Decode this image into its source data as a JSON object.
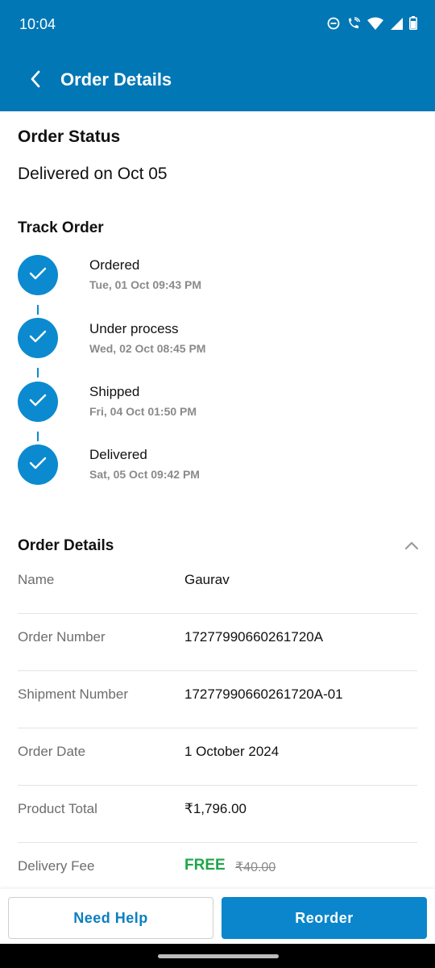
{
  "status_bar": {
    "time": "10:04",
    "icons": [
      "do-not-disturb-icon",
      "wifi-calling-icon",
      "wifi-icon",
      "signal-icon",
      "battery-icon"
    ]
  },
  "app_bar": {
    "title": "Order Details",
    "back_icon": "chevron-left-icon"
  },
  "order_status": {
    "title": "Order Status",
    "delivered_text": "Delivered on Oct 05"
  },
  "track": {
    "title": "Track Order",
    "steps": [
      {
        "label": "Ordered",
        "time": "Tue, 01 Oct 09:43 PM"
      },
      {
        "label": "Under process",
        "time": "Wed, 02 Oct 08:45 PM"
      },
      {
        "label": "Shipped",
        "time": "Fri, 04 Oct 01:50 PM"
      },
      {
        "label": "Delivered",
        "time": "Sat, 05 Oct 09:42 PM"
      }
    ]
  },
  "details": {
    "title": "Order Details",
    "rows": [
      {
        "label": "Name",
        "value": "Gaurav"
      },
      {
        "label": "Order Number",
        "value": "17277990660261720A"
      },
      {
        "label": "Shipment Number",
        "value": "17277990660261720A-01"
      },
      {
        "label": "Order Date",
        "value": "1 October 2024"
      },
      {
        "label": "Product Total",
        "value": "₹1,796.00"
      }
    ],
    "delivery_fee": {
      "label": "Delivery Fee",
      "value": "FREE",
      "original": "₹40.00"
    }
  },
  "actions": {
    "help_label": "Need Help",
    "reorder_label": "Reorder"
  },
  "colors": {
    "primary": "#0277b5",
    "accent": "#0b8ad0",
    "free_green": "#1fa64a"
  }
}
